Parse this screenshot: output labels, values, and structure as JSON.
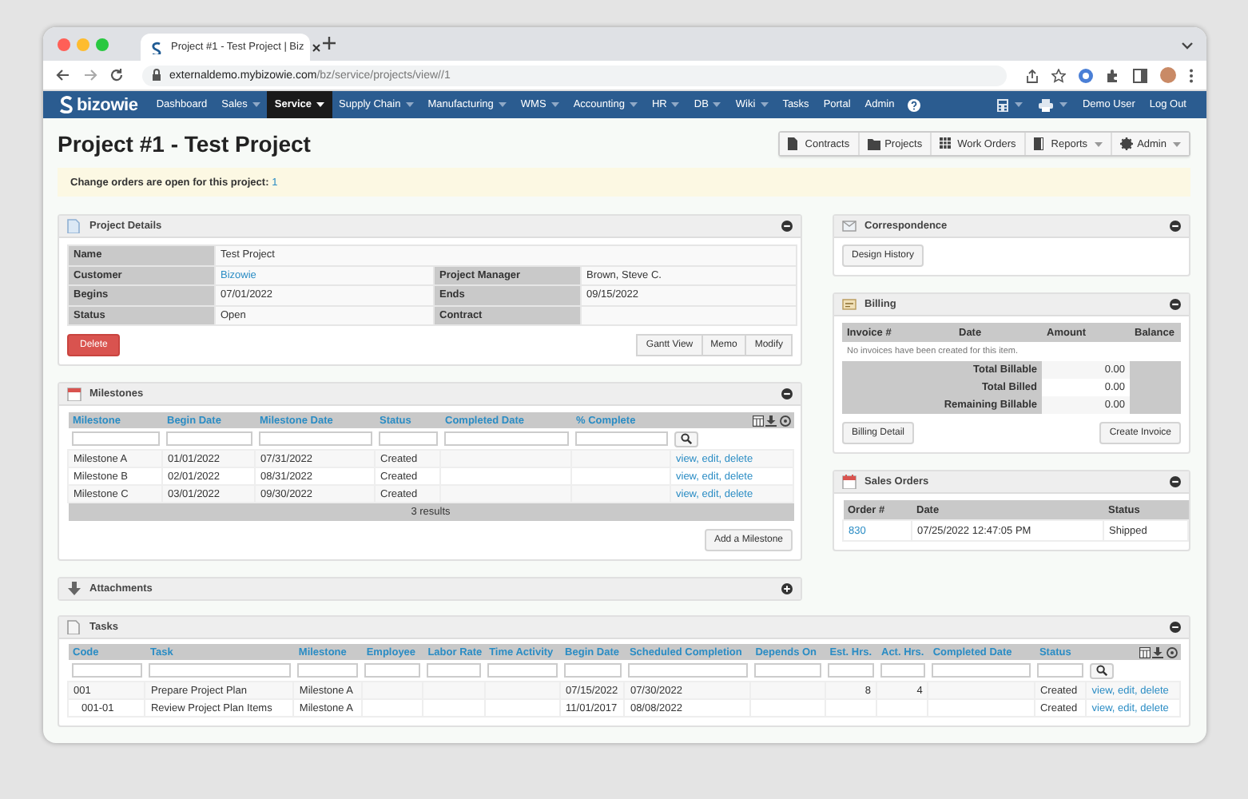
{
  "browser": {
    "tabs": [
      {
        "title": "Project #1 - Test Project | Biz",
        "selected": true
      }
    ],
    "url_host": "externaldemo.mybizowie.com",
    "url_path": "/bz/service/projects/view//1"
  },
  "nav": {
    "logo": "bizowie",
    "items": [
      {
        "label": "Dashboard",
        "dropdown": false,
        "selected": false
      },
      {
        "label": "Sales",
        "dropdown": true,
        "selected": false
      },
      {
        "label": "Service",
        "dropdown": true,
        "selected": true
      },
      {
        "label": "Supply Chain",
        "dropdown": true,
        "selected": false
      },
      {
        "label": "Manufacturing",
        "dropdown": true,
        "selected": false
      },
      {
        "label": "WMS",
        "dropdown": true,
        "selected": false
      },
      {
        "label": "Accounting",
        "dropdown": true,
        "selected": false
      },
      {
        "label": "HR",
        "dropdown": true,
        "selected": false
      },
      {
        "label": "DB",
        "dropdown": true,
        "selected": false
      },
      {
        "label": "Wiki",
        "dropdown": true,
        "selected": false
      },
      {
        "label": "Tasks",
        "dropdown": false,
        "selected": false
      },
      {
        "label": "Portal",
        "dropdown": false,
        "selected": false
      },
      {
        "label": "Admin",
        "dropdown": false,
        "selected": false
      }
    ],
    "user": "Demo User",
    "logout": "Log Out"
  },
  "page": {
    "title": "Project #1 - Test Project",
    "actions": [
      {
        "label": "Contracts",
        "dropdown": false
      },
      {
        "label": "Projects",
        "dropdown": false
      },
      {
        "label": "Work Orders",
        "dropdown": false
      },
      {
        "label": "Reports",
        "dropdown": true
      },
      {
        "label": "Admin",
        "dropdown": true
      }
    ]
  },
  "alert": {
    "text": "Change orders are open for this project:",
    "count": "1"
  },
  "project_details": {
    "title": "Project Details",
    "collapsed": false,
    "rows": [
      [
        {
          "label": "Name",
          "value": "Test Project",
          "kind": "text"
        }
      ],
      [
        {
          "label": "Customer",
          "value": "Bizowie",
          "kind": "link"
        },
        {
          "label": "Project Manager",
          "value": "Brown, Steve C.",
          "kind": "text"
        }
      ],
      [
        {
          "label": "Begins",
          "value": "07/01/2022",
          "kind": "text"
        },
        {
          "label": "Ends",
          "value": "09/15/2022",
          "kind": "text"
        }
      ],
      [
        {
          "label": "Status",
          "value": "Open",
          "kind": "text"
        },
        {
          "label": "Contract"
        }
      ]
    ],
    "danger_button": "Delete",
    "buttons": [
      "Gantt View",
      "Memo",
      "Modify"
    ]
  },
  "milestones": {
    "title": "Milestones",
    "collapsed": false,
    "columns": [
      "Milestone",
      "Begin Date",
      "Milestone Date",
      "Status",
      "Completed Date",
      "% Complete"
    ],
    "rows": [
      {
        "cells": [
          "Milestone A",
          "01/01/2022",
          "07/31/2022",
          "Created",
          null,
          null
        ],
        "actions": [
          "view,",
          "edit,",
          "delete"
        ]
      },
      {
        "cells": [
          "Milestone B",
          "02/01/2022",
          "08/31/2022",
          "Created",
          null,
          null
        ],
        "actions": [
          "view,",
          "edit,",
          "delete"
        ]
      },
      {
        "cells": [
          "Milestone C",
          "03/01/2022",
          "09/30/2022",
          "Created",
          null,
          null
        ],
        "actions": [
          "view,",
          "edit,",
          "delete"
        ]
      }
    ],
    "footer": "3 results",
    "button": "Add a Milestone"
  },
  "attachments": {
    "title": "Attachments",
    "collapsed": true
  },
  "tasks": {
    "title": "Tasks",
    "collapsed": false,
    "columns": [
      "Code",
      "Task",
      "Milestone",
      "Employee",
      "Labor Rate",
      "Time Activity",
      "Begin Date",
      "Scheduled Completion",
      "Depends On",
      "Est. Hrs.",
      "Act. Hrs.",
      "Completed Date",
      "Status"
    ],
    "rows": [
      {
        "cells": [
          "001",
          "Prepare Project Plan",
          "Milestone A",
          null,
          null,
          null,
          "07/15/2022",
          "07/30/2022",
          null,
          "8",
          "4",
          null,
          "Created"
        ],
        "actions": [
          "view,",
          "edit,",
          "delete"
        ],
        "children": [
          {
            "cells": [
              "001-01",
              "Review Project Plan Items",
              "Milestone A",
              null,
              null,
              null,
              "11/01/2017",
              "08/08/2022",
              null,
              null,
              null,
              null,
              "Created"
            ],
            "actions": [
              "view,",
              "edit,",
              "delete"
            ]
          }
        ]
      }
    ]
  },
  "correspondence": {
    "title": "Correspondence",
    "collapsed": false,
    "buttons": [
      "Design History"
    ]
  },
  "billing": {
    "title": "Billing",
    "collapsed": false,
    "columns": [
      "Invoice #",
      "Date",
      "Amount",
      "Balance"
    ],
    "empty_message": "No invoices have been created for this item.",
    "totals": [
      {
        "label": "Total Billable",
        "value": "0.00"
      },
      {
        "label": "Total Billed",
        "value": "0.00"
      },
      {
        "label": "Remaining Billable",
        "value": "0.00"
      }
    ],
    "buttons": [
      "Billing Detail",
      "Create Invoice"
    ]
  },
  "sales_orders": {
    "title": "Sales Orders",
    "collapsed": false,
    "columns": [
      "Order #",
      "Date",
      "Status"
    ],
    "rows": [
      {
        "order": "830",
        "date": "07/25/2022 12:47:05 PM",
        "status": "Shipped"
      }
    ]
  }
}
